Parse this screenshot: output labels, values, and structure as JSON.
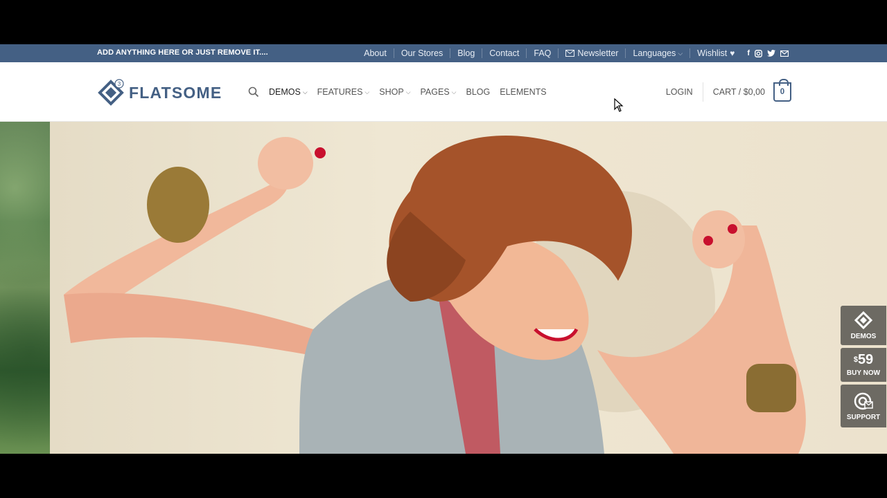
{
  "topbar": {
    "promo": "ADD ANYTHING HERE OR JUST REMOVE IT....",
    "links": [
      "About",
      "Our Stores",
      "Blog",
      "Contact",
      "FAQ"
    ],
    "newsletter": "Newsletter",
    "languages": "Languages",
    "wishlist": "Wishlist",
    "social_icons": [
      "facebook-icon",
      "instagram-icon",
      "twitter-icon",
      "email-icon"
    ]
  },
  "header": {
    "logo_text": "FLATSOME",
    "logo_badge": "3",
    "nav": [
      "DEMOS",
      "FEATURES",
      "SHOP",
      "PAGES",
      "BLOG",
      "ELEMENTS"
    ],
    "login": "LOGIN",
    "cart": "CART / $0,00",
    "cart_count": "0"
  },
  "sidetabs": {
    "demos": "DEMOS",
    "price": "59",
    "buy": "BUY NOW",
    "support": "SUPPORT"
  },
  "colors": {
    "brand": "#446084",
    "tab_bg": "#6d6a63"
  }
}
